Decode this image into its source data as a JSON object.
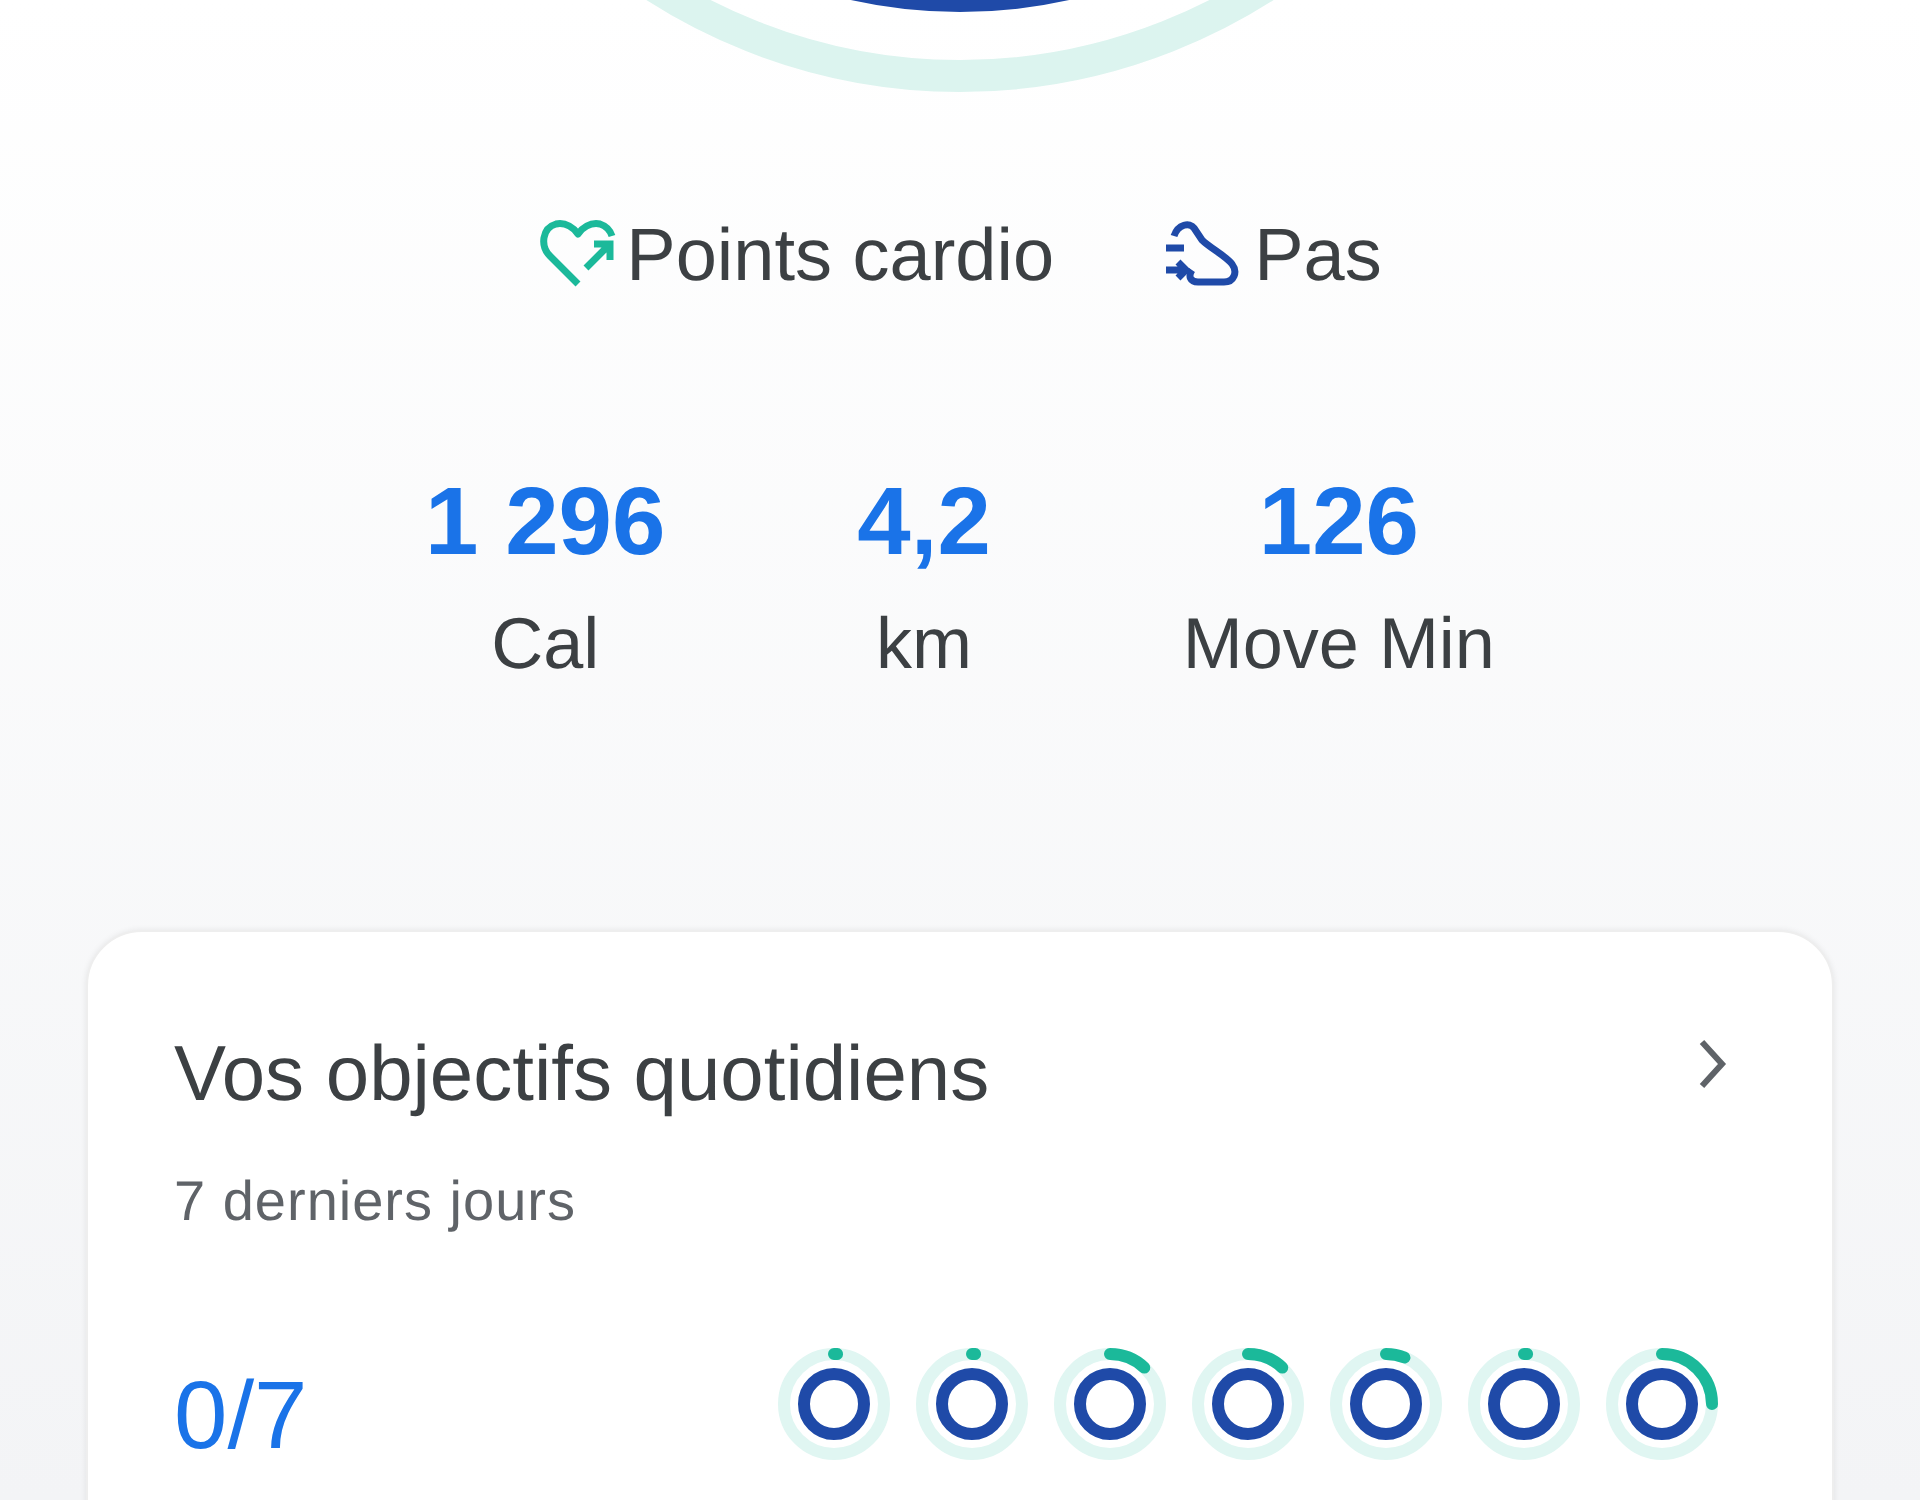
{
  "legend": [
    {
      "kind": "cardio",
      "label": "Points cardio"
    },
    {
      "kind": "steps",
      "label": "Pas"
    }
  ],
  "stats": [
    {
      "value": "1 296",
      "label": "Cal"
    },
    {
      "value": "4,2",
      "label": "km"
    },
    {
      "value": "126",
      "label": "Move Min"
    }
  ],
  "goals_card": {
    "title": "Vos objectifs quotidiens",
    "subtitle": "7 derniers jours",
    "achieved": "0/7",
    "days": [
      {
        "level": 0.01
      },
      {
        "level": 0.01
      },
      {
        "level": 0.12
      },
      {
        "level": 0.12
      },
      {
        "level": 0.06
      },
      {
        "level": 0.01
      },
      {
        "level": 0.25
      }
    ]
  }
}
